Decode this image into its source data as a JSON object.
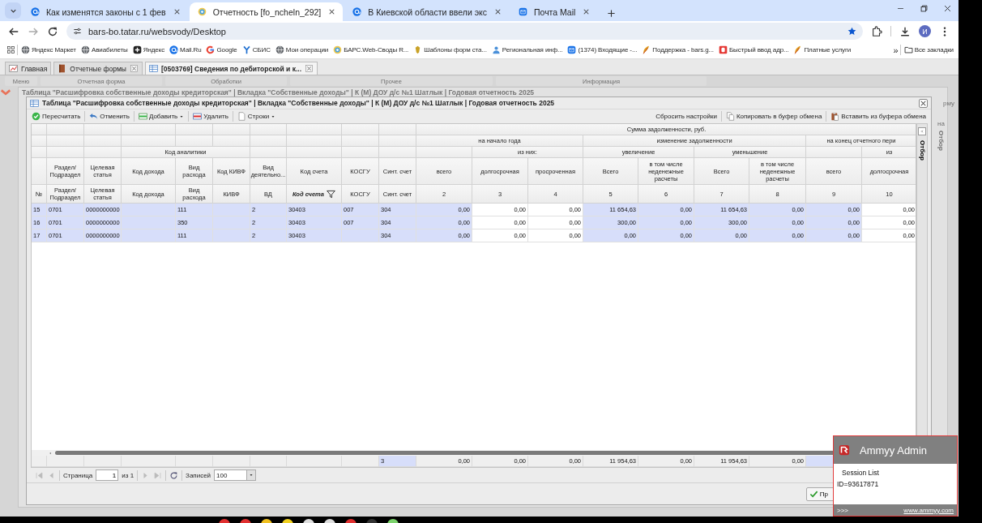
{
  "browser_tabs": [
    {
      "title": "Как изменятся законы с 1 фев",
      "selected": false,
      "kind": "at"
    },
    {
      "title": "Отчетность [fo_ncheln_292]",
      "selected": true,
      "kind": "bars"
    },
    {
      "title": "В Киевской области ввели экс",
      "selected": false,
      "kind": "at"
    },
    {
      "title": "Почта Mail",
      "selected": false,
      "kind": "mail"
    }
  ],
  "address_bar": {
    "url": "bars-bo.tatar.ru/websvody/Desktop",
    "profile_initial": "И"
  },
  "bookmarks": [
    {
      "label": "Яндекс Маркет",
      "kind": "globe"
    },
    {
      "label": "Авиабилеты",
      "kind": "globe"
    },
    {
      "label": "Яндекс",
      "kind": "dark"
    },
    {
      "label": "Mail.Ru",
      "kind": "at"
    },
    {
      "label": "Google",
      "kind": "g"
    },
    {
      "label": "СБИС",
      "kind": "y"
    },
    {
      "label": "Мои операции",
      "kind": "globe"
    },
    {
      "label": "БАРС.Web-Своды R...",
      "kind": "bars"
    },
    {
      "label": "Шаблоны форм ста...",
      "kind": "emblem"
    },
    {
      "label": "Региональная инф...",
      "kind": "person"
    },
    {
      "label": "(1374) Входящие -...",
      "kind": "mail"
    },
    {
      "label": "Поддержка - bars.g...",
      "kind": "feather"
    },
    {
      "label": "Быстрый ввод адр...",
      "kind": "d"
    },
    {
      "label": "Платные услуги",
      "kind": "feather"
    }
  ],
  "bookmarks_more": "»",
  "all_bookmarks": "Все закладки",
  "app_tabs": [
    {
      "title": "Главная",
      "selected": false,
      "closable": false,
      "kind": "home"
    },
    {
      "title": "Отчетные формы",
      "selected": false,
      "closable": true,
      "kind": "book"
    },
    {
      "title": "[0503769] Сведения по дебиторской и к...",
      "selected": true,
      "closable": true,
      "kind": "grid"
    }
  ],
  "menu": [
    "Меню",
    "Отчетная форма",
    "Обработки",
    "Прочее",
    "Информация"
  ],
  "side_texts": [
    "рму",
    "на"
  ],
  "back_window": {
    "title": "Таблица \"Расшифровка собственные доходы кредиторская\" | Вкладка \"Собственные доходы\" | К (М) ДОУ д/с №1 Шатлык | Годовая отчетность 2025",
    "side_tab": "Отбор"
  },
  "window": {
    "title": "Таблица \"Расшифровка собственные доходы кредиторская\" | Вкладка \"Собственные доходы\" | К (М) ДОУ д/с №1 Шатлык | Годовая отчетность 2025",
    "toolbar_left": [
      {
        "label": "Пересчитать",
        "kind": "check",
        "dropdown": false
      },
      {
        "label": "Отменить",
        "kind": "undo",
        "dropdown": false
      },
      {
        "label": "Добавить",
        "kind": "add",
        "dropdown": true
      },
      {
        "label": "Удалить",
        "kind": "delete",
        "dropdown": false
      },
      {
        "label": "Строки",
        "kind": "rows",
        "dropdown": true
      }
    ],
    "toolbar_right": [
      {
        "label": "Сбросить настройки"
      },
      {
        "label": "Копировать в буфер обмена",
        "kind": "copy"
      },
      {
        "label": "Вставить из буфера обмена",
        "kind": "paste"
      }
    ],
    "side_tab": "Отбор",
    "header_rows": [
      [
        {},
        {},
        {},
        {},
        {},
        {},
        {},
        {},
        {},
        {},
        {
          "text": "Сумма задолженности, руб."
        }
      ],
      [
        {},
        {},
        {},
        {},
        {},
        {},
        {},
        {},
        {},
        {},
        {
          "text": "на начало года"
        },
        {
          "text": "изменение задолженности"
        },
        {
          "text": "на конец отчетного пери"
        }
      ],
      [
        {},
        {},
        {},
        {
          "text": "Код аналитики"
        },
        {},
        {},
        {},
        {},
        {},
        {
          "text": "из них:"
        },
        {
          "text": "увеличение"
        },
        {
          "text": "уменьшение"
        },
        {},
        {
          "text": "из"
        }
      ],
      [
        {},
        {
          "text": "Раздел/ Подраздел"
        },
        {
          "text": "Целевая статья"
        },
        {
          "text": "Код дохода"
        },
        {
          "text": "Вид расхода"
        },
        {
          "text": "Код КИВФ"
        },
        {
          "text": "Вид деятельно..."
        },
        {
          "text": "Код счета"
        },
        {
          "text": "КОСГУ"
        },
        {
          "text": "Синт. счет"
        },
        {
          "text": "всего"
        },
        {
          "text": "долгосрочная"
        },
        {
          "text": "просроченная"
        },
        {
          "text": "Всего"
        },
        {
          "text": "в том числе неденежные расчеты"
        },
        {
          "text": "Всего"
        },
        {
          "text": "в том числе неденежные расчеты"
        },
        {
          "text": "всего"
        },
        {
          "text": "долгосрочная"
        }
      ],
      [
        {
          "text": "№",
          "filtered": false
        },
        {
          "text": "Раздел/ Подраздел",
          "filtered": false
        },
        {
          "text": "Целевая статья",
          "filtered": false
        },
        {
          "text": "Код дохода",
          "filtered": false
        },
        {
          "text": "Вид расхода",
          "filtered": false
        },
        {
          "text": "КИВФ",
          "filtered": false
        },
        {
          "text": "ВД",
          "filtered": false
        },
        {
          "text": "Код счета",
          "filtered": true
        },
        {
          "text": "КОСГУ",
          "filtered": false
        },
        {
          "text": "Синт. счет",
          "filtered": false
        },
        {
          "text": "2",
          "filtered": false
        },
        {
          "text": "3",
          "filtered": false
        },
        {
          "text": "4",
          "filtered": false
        },
        {
          "text": "5",
          "filtered": false
        },
        {
          "text": "6",
          "filtered": false
        },
        {
          "text": "7",
          "filtered": false
        },
        {
          "text": "8",
          "filtered": false
        },
        {
          "text": "9",
          "filtered": false
        },
        {
          "text": "10",
          "filtered": false
        }
      ]
    ],
    "columns": [
      {
        "highlighted": true,
        "numeric": false
      },
      {
        "highlighted": true,
        "numeric": false
      },
      {
        "highlighted": true,
        "numeric": false
      },
      {
        "highlighted": true,
        "numeric": false
      },
      {
        "highlighted": true,
        "numeric": false
      },
      {
        "highlighted": true,
        "numeric": false
      },
      {
        "highlighted": true,
        "numeric": false
      },
      {
        "highlighted": true,
        "numeric": false
      },
      {
        "highlighted": true,
        "numeric": false
      },
      {
        "highlighted": true,
        "numeric": false
      },
      {
        "highlighted": true,
        "numeric": true
      },
      {
        "highlighted": false,
        "numeric": true
      },
      {
        "highlighted": false,
        "numeric": true
      },
      {
        "highlighted": true,
        "numeric": true
      },
      {
        "highlighted": true,
        "numeric": true
      },
      {
        "highlighted": true,
        "numeric": true
      },
      {
        "highlighted": true,
        "numeric": true
      },
      {
        "highlighted": true,
        "numeric": true
      },
      {
        "highlighted": false,
        "numeric": true
      }
    ],
    "rows": [
      [
        "15",
        "0701",
        "0000000000",
        null,
        "111",
        null,
        "2",
        "30403",
        "007",
        "304",
        "0,00",
        "0,00",
        "0,00",
        "11 654,63",
        "0,00",
        "11 654,63",
        "0,00",
        "0,00",
        "0,00"
      ],
      [
        "16",
        "0701",
        "0000000000",
        null,
        "350",
        null,
        "2",
        "30403",
        "007",
        "304",
        "0,00",
        "0,00",
        "0,00",
        "300,00",
        "0,00",
        "300,00",
        "0,00",
        "0,00",
        "0,00"
      ],
      [
        "17",
        "0701",
        "0000000000",
        null,
        "111",
        null,
        "2",
        "30403",
        null,
        "304",
        "0,00",
        "0,00",
        "0,00",
        "0,00",
        "0,00",
        "0,00",
        "0,00",
        "0,00",
        "0,00"
      ]
    ],
    "footer": [
      {
        "highlighted": false
      },
      {
        "highlighted": false
      },
      {
        "highlighted": false
      },
      {
        "highlighted": false
      },
      {
        "highlighted": false
      },
      {
        "highlighted": false
      },
      {
        "highlighted": false
      },
      {
        "highlighted": false
      },
      {
        "highlighted": false
      },
      {
        "text": "3",
        "highlighted": true
      },
      {
        "text": "0,00",
        "highlighted": false
      },
      {
        "text": "0,00",
        "highlighted": false
      },
      {
        "text": "0,00",
        "highlighted": false
      },
      {
        "text": "11 954,63",
        "highlighted": false
      },
      {
        "text": "0,00",
        "highlighted": false
      },
      {
        "text": "11 954,63",
        "highlighted": false
      },
      {
        "text": "0,00",
        "highlighted": false
      },
      {
        "highlighted": true
      }
    ],
    "pager": {
      "page_label": "Страница",
      "page": "1",
      "of": "из 1",
      "records_label": "Записей",
      "records": "100"
    },
    "ok_button": "Пр"
  },
  "popup": {
    "title": "Ammyy Admin",
    "session": "Session List",
    "id": "ID=93617871",
    "more": ">>>",
    "link": "www.ammyy.com"
  }
}
